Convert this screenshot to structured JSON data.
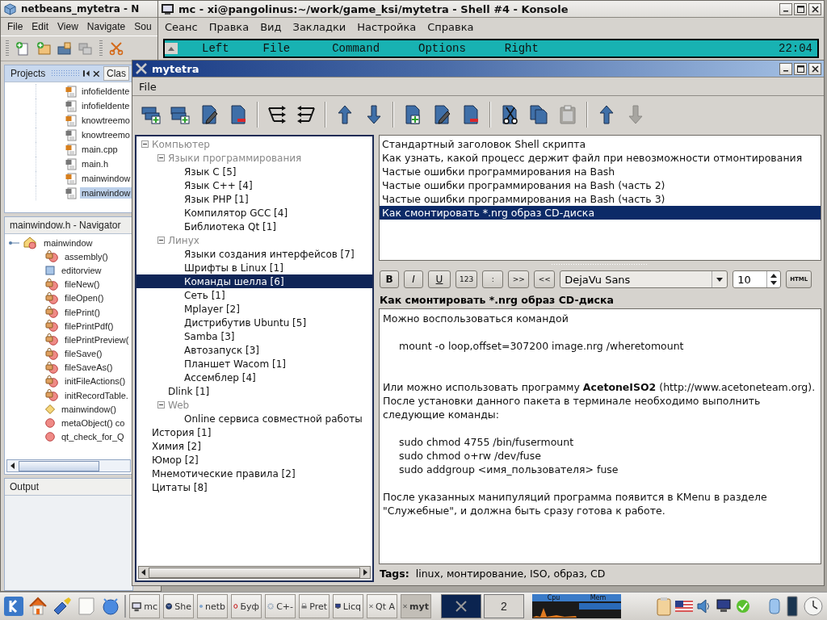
{
  "netbeans": {
    "title": "netbeans_mytetra - N",
    "menu": [
      "File",
      "Edit",
      "View",
      "Navigate",
      "Sou"
    ],
    "tabs": [
      {
        "label": "Projects",
        "selected": true
      },
      {
        "label": "Clas",
        "selected": false
      }
    ],
    "files": [
      {
        "name": "infofieldente",
        "kind": "cpp",
        "selected": false
      },
      {
        "name": "infofieldente",
        "kind": "h",
        "selected": false
      },
      {
        "name": "knowtreemo",
        "kind": "cpp",
        "selected": false
      },
      {
        "name": "knowtreemo",
        "kind": "h",
        "selected": false
      },
      {
        "name": "main.cpp",
        "kind": "cpp",
        "selected": false
      },
      {
        "name": "main.h",
        "kind": "h",
        "selected": false
      },
      {
        "name": "mainwindow",
        "kind": "cpp",
        "selected": false
      },
      {
        "name": "mainwindow",
        "kind": "h",
        "selected": true
      }
    ],
    "navigator": {
      "title": "mainwindow.h - Navigator",
      "root": "mainwindow",
      "items": [
        {
          "name": "assembly()",
          "kind": "private"
        },
        {
          "name": "editorview",
          "kind": "field"
        },
        {
          "name": "fileNew()",
          "kind": "private"
        },
        {
          "name": "fileOpen()",
          "kind": "private"
        },
        {
          "name": "filePrint()",
          "kind": "private"
        },
        {
          "name": "filePrintPdf()",
          "kind": "private"
        },
        {
          "name": "filePrintPreview(",
          "kind": "private"
        },
        {
          "name": "fileSave()",
          "kind": "private"
        },
        {
          "name": "fileSaveAs()",
          "kind": "private"
        },
        {
          "name": "initFileActions()",
          "kind": "private"
        },
        {
          "name": "initRecordTable.",
          "kind": "private"
        },
        {
          "name": "mainwindow()",
          "kind": "constructor"
        },
        {
          "name": "metaObject() co",
          "kind": "method"
        },
        {
          "name": "qt_check_for_Q",
          "kind": "method"
        }
      ]
    },
    "output": {
      "title": "Output"
    }
  },
  "konsole": {
    "title": "mc - xi@pangolinus:~/work/game_ksi/mytetra - Shell #4 - Konsole",
    "menu": [
      "Сеанс",
      "Правка",
      "Вид",
      "Закладки",
      "Настройка",
      "Справка"
    ],
    "mc_menu": [
      "Left",
      "File",
      "Command",
      "Options",
      "Right"
    ],
    "clock": "22:04"
  },
  "mytetra": {
    "title": "mytetra",
    "menu": [
      "File"
    ],
    "toolbar": [
      {
        "tools": [
          {
            "kind": "add-branch",
            "disabled": false
          },
          {
            "kind": "add-subbranch",
            "disabled": false
          },
          {
            "kind": "edit",
            "disabled": false
          },
          {
            "kind": "delete",
            "disabled": false
          }
        ]
      },
      {
        "tools": [
          {
            "kind": "expand",
            "disabled": false
          },
          {
            "kind": "collapse",
            "disabled": false
          }
        ]
      },
      {
        "tools": [
          {
            "kind": "up",
            "disabled": false
          },
          {
            "kind": "down",
            "disabled": false
          }
        ]
      },
      {
        "tools": [
          {
            "kind": "add",
            "disabled": false
          },
          {
            "kind": "edit",
            "disabled": false
          },
          {
            "kind": "delete",
            "disabled": false
          }
        ]
      },
      {
        "tools": [
          {
            "kind": "cut",
            "disabled": false
          },
          {
            "kind": "copy",
            "disabled": false
          },
          {
            "kind": "paste",
            "disabled": true
          }
        ]
      },
      {
        "tools": [
          {
            "kind": "up",
            "disabled": false
          },
          {
            "kind": "down",
            "disabled": true
          }
        ]
      }
    ],
    "tree": [
      {
        "label": "Компьютер",
        "expanded": true,
        "selected": false,
        "children": [
          {
            "label": "Языки программирования",
            "expanded": true,
            "selected": false,
            "children": [
              {
                "label": "Язык C [5]",
                "selected": false
              },
              {
                "label": "Язык C++ [4]",
                "selected": false
              },
              {
                "label": "Язык PHP [1]",
                "selected": false
              },
              {
                "label": "Компилятор GCC [4]",
                "selected": false
              },
              {
                "label": "Библиотека Qt [1]",
                "selected": false
              }
            ]
          },
          {
            "label": "Линух",
            "expanded": true,
            "selected": false,
            "children": [
              {
                "label": "Языки создания интерфейсов [7]",
                "selected": false
              },
              {
                "label": "Шрифты в Linux [1]",
                "selected": false
              },
              {
                "label": "Команды шелла [6]",
                "selected": true
              },
              {
                "label": "Сеть [1]",
                "selected": false
              },
              {
                "label": "Mplayer [2]",
                "selected": false
              },
              {
                "label": "Дистрибутив Ubuntu [5]",
                "selected": false
              },
              {
                "label": "Samba [3]",
                "selected": false
              },
              {
                "label": "Автозапуск [3]",
                "selected": false
              },
              {
                "label": "Планшет Wacom [1]",
                "selected": false
              },
              {
                "label": "Ассемблер [4]",
                "selected": false
              }
            ]
          },
          {
            "label": "Dlink [1]",
            "selected": false
          },
          {
            "label": "Web",
            "expanded": true,
            "selected": false,
            "children": [
              {
                "label": "Online сервиса совместной работы",
                "selected": false
              }
            ]
          }
        ]
      },
      {
        "label": "История [1]",
        "selected": false
      },
      {
        "label": "Химия [2]",
        "selected": false
      },
      {
        "label": "Юмор [2]",
        "selected": false
      },
      {
        "label": "Мнемотические правила [2]",
        "selected": false
      },
      {
        "label": "Цитаты [8]",
        "selected": false
      }
    ],
    "records": [
      {
        "title": "Стандартный заголовок Shell скрипта",
        "selected": false
      },
      {
        "title": "Как узнать, какой процесс держит файл при невозможности отмонтирования",
        "selected": false
      },
      {
        "title": "Частые ошибки программирования на Bash",
        "selected": false
      },
      {
        "title": "Частые ошибки программирования на Bash (часть 2)",
        "selected": false
      },
      {
        "title": "Частые ошибки программирования на Bash (часть 3)",
        "selected": false
      },
      {
        "title": "Как смонтировать *.nrg образ CD-диска",
        "selected": true
      }
    ],
    "format_buttons": [
      {
        "label": "B",
        "kind": "bold"
      },
      {
        "label": "I",
        "kind": "italic"
      },
      {
        "label": "U",
        "kind": "underline"
      },
      {
        "label": "123",
        "kind": "small"
      },
      {
        "label": ":",
        "kind": "small"
      },
      {
        "label": ">>",
        "kind": "small"
      },
      {
        "label": "<<",
        "kind": "small"
      }
    ],
    "font": "DejaVu Sans",
    "size": "10",
    "html_button": "HTML",
    "record_title": "Как смонтировать *.nrg образ CD-диска",
    "editor": [
      {
        "kind": "text",
        "lines": [
          "Можно воспользоваться командой"
        ]
      },
      {
        "kind": "code",
        "lines": [
          "mount -o loop,offset=307200 image.nrg /wheretomount"
        ]
      },
      {
        "kind": "text",
        "lines": [
          "Или можно использовать программу **AcetoneISO2** (http://www.acetoneteam.org).",
          "После установки данного пакета в терминале необходимо выполнить следующие команды:"
        ]
      },
      {
        "kind": "code",
        "lines": [
          "sudo chmod 4755 /bin/fusermount",
          "sudo chmod o+rw /dev/fuse",
          "sudo addgroup <имя_пользователя> fuse"
        ]
      },
      {
        "kind": "text",
        "lines": [
          "После указанных манипуляций программа появится в KMenu в разделе \"Служебные\", и должна быть сразу готова к работе."
        ]
      }
    ],
    "tags_label": "Tags:",
    "tags": "linux, монтирование, ISO, образ, CD"
  },
  "taskbar": {
    "tasks": [
      {
        "label": "mc",
        "kind": "terminal",
        "selected": false
      },
      {
        "label": "She",
        "kind": "globe",
        "selected": false
      },
      {
        "label": "netb",
        "kind": "cube",
        "selected": false
      },
      {
        "label": "Буф",
        "kind": "opera",
        "selected": false
      },
      {
        "label": "C+-",
        "kind": "gear",
        "selected": false
      },
      {
        "label": "Pret",
        "kind": "printer",
        "selected": false
      },
      {
        "label": "Licq",
        "kind": "monitor",
        "selected": false
      },
      {
        "label": "Qt A",
        "kind": "x",
        "selected": false
      },
      {
        "label": "myt",
        "kind": "x",
        "selected": true
      }
    ],
    "desktops": [
      {
        "selected": true
      },
      {
        "label": "2",
        "selected": false
      }
    ],
    "monitor_labels": [
      "Cpu",
      "Mem"
    ]
  }
}
